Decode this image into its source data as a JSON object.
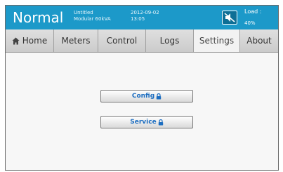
{
  "header": {
    "status": "Normal",
    "model_line1": "Untitled",
    "model_line2": "Modular 60kVA",
    "date": "2012-09-02",
    "time": "13:05",
    "load_label": "Load :",
    "load_value": "40%",
    "colors": {
      "header_bg": "#1c99c9"
    }
  },
  "tabs": [
    {
      "label": "Home",
      "icon": "home-icon"
    },
    {
      "label": "Meters"
    },
    {
      "label": "Control"
    },
    {
      "label": "Logs"
    },
    {
      "label": "Settings",
      "active": true
    },
    {
      "label": "About"
    }
  ],
  "main": {
    "buttons": [
      {
        "label": "Config",
        "icon": "lock-icon"
      },
      {
        "label": "Service",
        "icon": "lock-icon"
      }
    ]
  }
}
